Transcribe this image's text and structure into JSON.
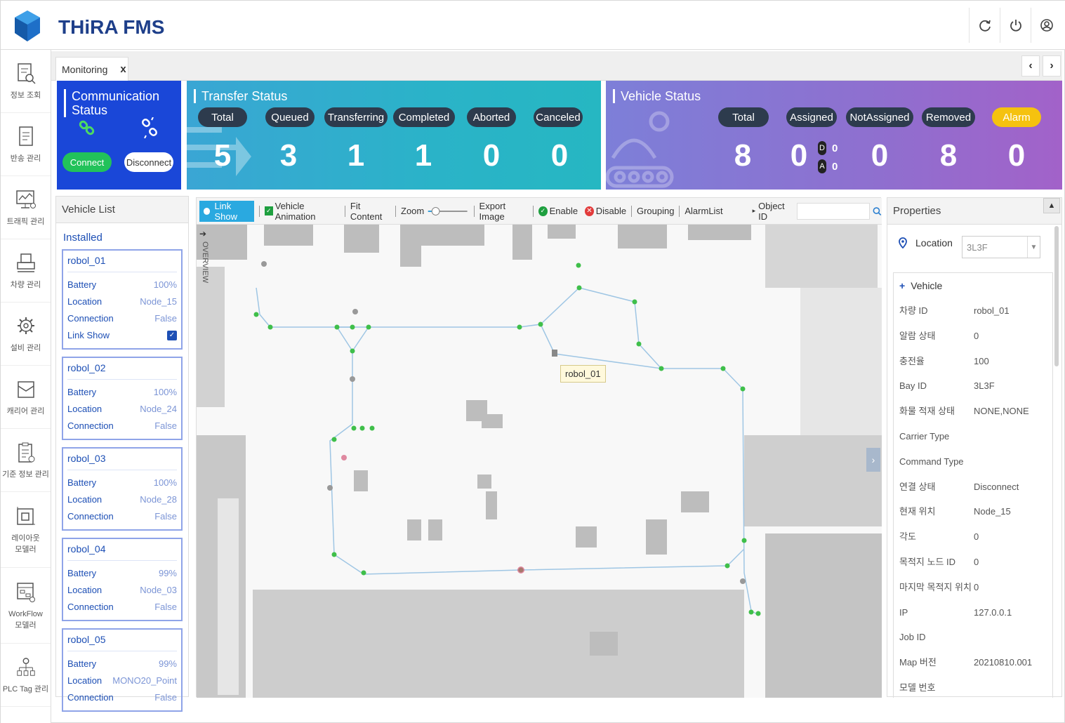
{
  "app": {
    "title": "THiRA FMS"
  },
  "top_actions": [
    "refresh-icon",
    "power-icon",
    "user-icon"
  ],
  "nav": [
    {
      "icon": "info-search-icon",
      "label": "정보 조회"
    },
    {
      "icon": "transfer-doc-icon",
      "label": "반송 관리"
    },
    {
      "icon": "traffic-monitor-icon",
      "label": "트래픽 관리"
    },
    {
      "icon": "vehicle-icon",
      "label": "차량 관리"
    },
    {
      "icon": "equipment-gear-icon",
      "label": "설비 관리"
    },
    {
      "icon": "carrier-box-icon",
      "label": "캐리어 관리"
    },
    {
      "icon": "clipboard-icon",
      "label": "기준 정보 관리"
    },
    {
      "icon": "layout-icon",
      "label": "레이아웃\n모델러"
    },
    {
      "icon": "workflow-icon",
      "label": "WorkFlow\n모델러"
    },
    {
      "icon": "plc-tag-icon",
      "label": "PLC Tag 관리"
    }
  ],
  "tabs": [
    {
      "label": "Monitoring",
      "close": "x"
    }
  ],
  "comm": {
    "title": "Communication Status",
    "connect": "Connect",
    "disconnect": "Disconnect"
  },
  "transfer": {
    "title": "Transfer Status",
    "items": [
      {
        "label": "Total",
        "value": "5"
      },
      {
        "label": "Queued",
        "value": "3"
      },
      {
        "label": "Transferring",
        "value": "1"
      },
      {
        "label": "Completed",
        "value": "1"
      },
      {
        "label": "Aborted",
        "value": "0"
      },
      {
        "label": "Canceled",
        "value": "0"
      }
    ]
  },
  "vehicle_status": {
    "title": "Vehicle Status",
    "items": [
      {
        "label": "Total",
        "value": "8"
      },
      {
        "label": "Assigned",
        "value": "0"
      },
      {
        "label": "NotAssigned",
        "value": "0"
      },
      {
        "label": "Removed",
        "value": "8"
      },
      {
        "label": "Alarm",
        "value": "0"
      }
    ],
    "sub": {
      "d_label": "D",
      "d_value": "0",
      "a_label": "A",
      "a_value": "0"
    },
    "alarm_color": "#f5c20f"
  },
  "vehicle_list": {
    "title": "Vehicle List",
    "group": "Installed",
    "link_show_label": "Link Show",
    "vehicles": [
      {
        "name": "robol_01",
        "battery": "100%",
        "location": "Node_15",
        "connection": "False",
        "link_show": true
      },
      {
        "name": "robol_02",
        "battery": "100%",
        "location": "Node_24",
        "connection": "False"
      },
      {
        "name": "robol_03",
        "battery": "100%",
        "location": "Node_28",
        "connection": "False"
      },
      {
        "name": "robol_04",
        "battery": "99%",
        "location": "Node_03",
        "connection": "False"
      },
      {
        "name": "robol_05",
        "battery": "99%",
        "location": "MONO20_Point",
        "connection": "False"
      }
    ],
    "labels": {
      "battery": "Battery",
      "location": "Location",
      "connection": "Connection"
    }
  },
  "toolbar": {
    "link_show": "Link Show",
    "vehicle_animation": "Vehicle Animation",
    "fit_content": "Fit Content",
    "zoom": "Zoom",
    "export_image": "Export Image",
    "enable": "Enable",
    "disable": "Disable",
    "grouping": "Grouping",
    "alarm_list": "AlarmList",
    "object_id": "Object ID"
  },
  "map": {
    "overview": "OVERVIEW",
    "tooltip": "robol_01"
  },
  "properties": {
    "title": "Properties",
    "location_label": "Location",
    "location_value": "3L3F",
    "section": "Vehicle",
    "rows": [
      {
        "k": "차량 ID",
        "v": "robol_01"
      },
      {
        "k": "알람 상태",
        "v": "0"
      },
      {
        "k": "충전율",
        "v": "100"
      },
      {
        "k": "Bay ID",
        "v": "3L3F"
      },
      {
        "k": "화물 적재 상태",
        "v": "NONE,NONE"
      },
      {
        "k": "Carrier Type",
        "v": ""
      },
      {
        "k": "Command Type",
        "v": ""
      },
      {
        "k": "연결 상태",
        "v": "Disconnect"
      },
      {
        "k": "현재 위치",
        "v": "Node_15"
      },
      {
        "k": "각도",
        "v": "0"
      },
      {
        "k": "목적지 노드 ID",
        "v": "0"
      },
      {
        "k": "마지막 목적지 위치",
        "v": "0"
      },
      {
        "k": "IP",
        "v": "127.0.0.1"
      },
      {
        "k": "Job ID",
        "v": ""
      },
      {
        "k": "Map 버전",
        "v": "20210810.001"
      },
      {
        "k": "모델 번호",
        "v": ""
      }
    ]
  }
}
